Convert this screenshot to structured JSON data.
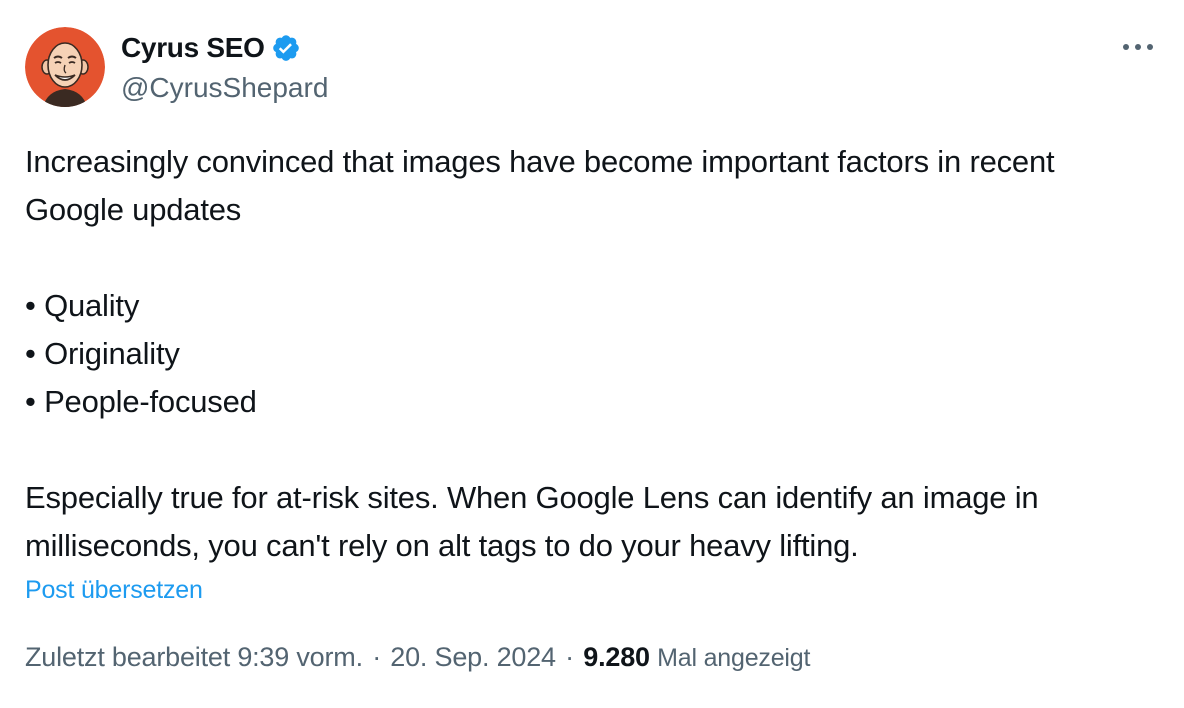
{
  "author": {
    "display_name": "Cyrus SEO",
    "handle": "@CyrusShepard",
    "verified": true,
    "avatar_icon": "cartoon-face-avatar",
    "avatar_bg": "#e4532f"
  },
  "menu": {
    "icon": "more-horizontal-icon"
  },
  "tweet": {
    "intro_line": "Increasingly convinced that images have become important factors in recent Google updates",
    "bullets": [
      "• Quality",
      "• Originality",
      "• People-focused"
    ],
    "closing": "Especially true for at-risk sites. When Google Lens can identify an image in milliseconds, you can't rely on alt tags to do your heavy lifting."
  },
  "translate_label": "Post übersetzen",
  "meta": {
    "edited_time": "Zuletzt bearbeitet 9:39 vorm.",
    "separator": "·",
    "date": "20. Sep. 2024",
    "views_count": "9.280",
    "views_label": "Mal angezeigt"
  },
  "colors": {
    "text": "#0f1419",
    "secondary": "#536471",
    "link": "#1d9bf0",
    "verified": "#1d9bf0"
  }
}
